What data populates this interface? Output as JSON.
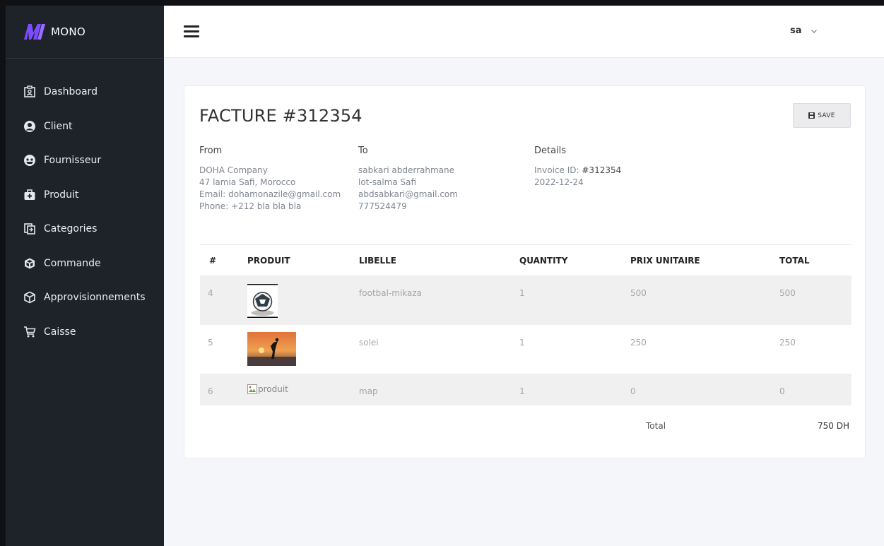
{
  "app": {
    "name": "MONO",
    "brand_color": "#7c4dff"
  },
  "sidebar": {
    "items": [
      {
        "label": "Dashboard",
        "icon": "dashboard-icon"
      },
      {
        "label": "Client",
        "icon": "user-circle-icon"
      },
      {
        "label": "Fournisseur",
        "icon": "supplier-icon"
      },
      {
        "label": "Produit",
        "icon": "medkit-icon"
      },
      {
        "label": "Categories",
        "icon": "copy-icon"
      },
      {
        "label": "Commande",
        "icon": "cube-icon"
      },
      {
        "label": "Approvisionnements",
        "icon": "box-icon"
      },
      {
        "label": "Caisse",
        "icon": "cart-icon"
      }
    ]
  },
  "header": {
    "user": "sa"
  },
  "invoice": {
    "title": "FACTURE #312354",
    "save_label": "SAVE",
    "from": {
      "heading": "From",
      "lines": [
        "DOHA Company",
        "47 lamia Safi, Morocco",
        "Email: dohamonazile@gmail.com",
        "Phone: +212 bla bla bla"
      ]
    },
    "to": {
      "heading": "To",
      "lines": [
        "sabkari abderrahmane",
        "lot-salma Safi",
        "abdsabkari@gmail.com",
        "777524479"
      ]
    },
    "details": {
      "heading": "Details",
      "invoice_id_label": "Invoice ID:",
      "invoice_id_value": "#312354",
      "date": "2022-12-24"
    },
    "columns": [
      "#",
      "PRODUIT",
      "LIBELLE",
      "QUANTITY",
      "PRIX UNITAIRE",
      "TOTAL"
    ],
    "rows": [
      {
        "id": "4",
        "image": "football",
        "libelle": "footbal-mikaza",
        "quantity": "1",
        "prix": "500",
        "total": "500"
      },
      {
        "id": "5",
        "image": "sunset",
        "libelle": "solei",
        "quantity": "1",
        "prix": "250",
        "total": "250"
      },
      {
        "id": "6",
        "image": "broken",
        "image_alt": "produit",
        "libelle": "map",
        "quantity": "1",
        "prix": "0",
        "total": "0"
      }
    ],
    "total_label": "Total",
    "total_value": "750 DH"
  }
}
